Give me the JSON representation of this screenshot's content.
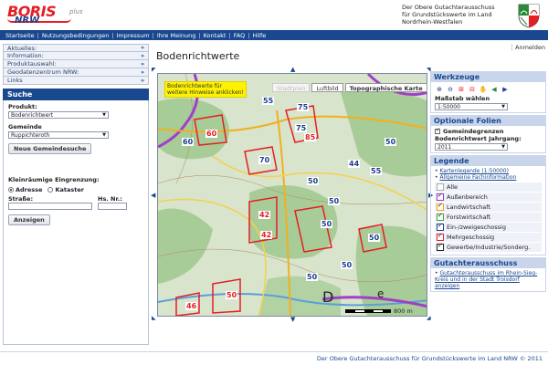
{
  "header": {
    "logo_main": "BORIS",
    "logo_plus": "plus",
    "logo_sub": "NRW",
    "org_line1": "Der Obere Gutachterausschuss",
    "org_line2": "für Grundstückswerte im Land",
    "org_line3": "Nordrhein-Westfalen"
  },
  "nav": {
    "items": [
      "Startseite",
      "Nutzungsbedingungen",
      "Impressum",
      "Ihre Meinung",
      "Kontakt",
      "FAQ",
      "Hilfe"
    ]
  },
  "account": {
    "login": "Anmelden"
  },
  "sidebar": {
    "accordion": [
      "Aktuelles:",
      "Information:",
      "Produktauswahl:",
      "Geodatenzentrum NRW:",
      "Links"
    ],
    "accordion_chevron": "»",
    "search": {
      "title": "Suche",
      "product_label": "Produkt:",
      "product_value": "Bodenrichtwert",
      "municipality_label": "Gemeinde",
      "municipality_value": "Ruppichteroth",
      "new_search_button": "Neue Gemeindesuche",
      "small_area_label": "Kleinräumige Eingrenzung:",
      "radio_address": "Adresse",
      "radio_cadastre": "Kataster",
      "street_label": "Straße:",
      "house_no_label": "Hs. Nr.:",
      "show_button": "Anzeigen"
    }
  },
  "main": {
    "title": "Bodenrichtwerte",
    "tooltip": "Bodenrichtwerte für weitere Hinweise anklicken!",
    "tabs": [
      {
        "label": "Stadtplan",
        "state": "inactive"
      },
      {
        "label": "Luftbild",
        "state": "normal"
      },
      {
        "label": "Topographische Karte",
        "state": "active"
      }
    ],
    "scale_label": "800 m",
    "map_values": [
      "55",
      "75",
      "60",
      "60",
      "75",
      "85",
      "50",
      "70",
      "50",
      "44",
      "55",
      "50",
      "42",
      "42",
      "50",
      "50",
      "50",
      "50",
      "46",
      "50"
    ]
  },
  "right": {
    "tools_title": "Werkzeuge",
    "scale_label": "Maßstab wählen",
    "scale_value": "1:50000",
    "optional_title": "Optionale Folien",
    "municipal_borders": "Gemeindegrenzen",
    "year_label": "Bodenrichtwert Jahrgang:",
    "year_value": "2011",
    "legend_title": "Legende",
    "legend_links": [
      "Kartenlegende (1:50000)",
      "Allgemeine Fachinformation"
    ],
    "legend_items": [
      {
        "label": "Alle",
        "color": "#aaaaaa"
      },
      {
        "label": "Außenbereich",
        "color": "#9933cc"
      },
      {
        "label": "Landwirtschaft",
        "color": "#ff9900"
      },
      {
        "label": "Forstwirtschaft",
        "color": "#33aa33"
      },
      {
        "label": "Ein-/zweigeschossig",
        "color": "#1c3f8c"
      },
      {
        "label": "Mehrgeschossig",
        "color": "#e41e25"
      },
      {
        "label": "Gewerbe/Industrie/Sonderg.",
        "color": "#222222"
      }
    ],
    "gutachter_title": "Gutachterausschuss",
    "gutachter_link": "Gutachterausschuss im Rhein-Sieg-Kreis und in der Stadt Troisdorf anzeigen"
  },
  "footer": {
    "text": "Der Obere Gutachterausschuss für Grundstückswerte im Land NRW © 2011"
  }
}
